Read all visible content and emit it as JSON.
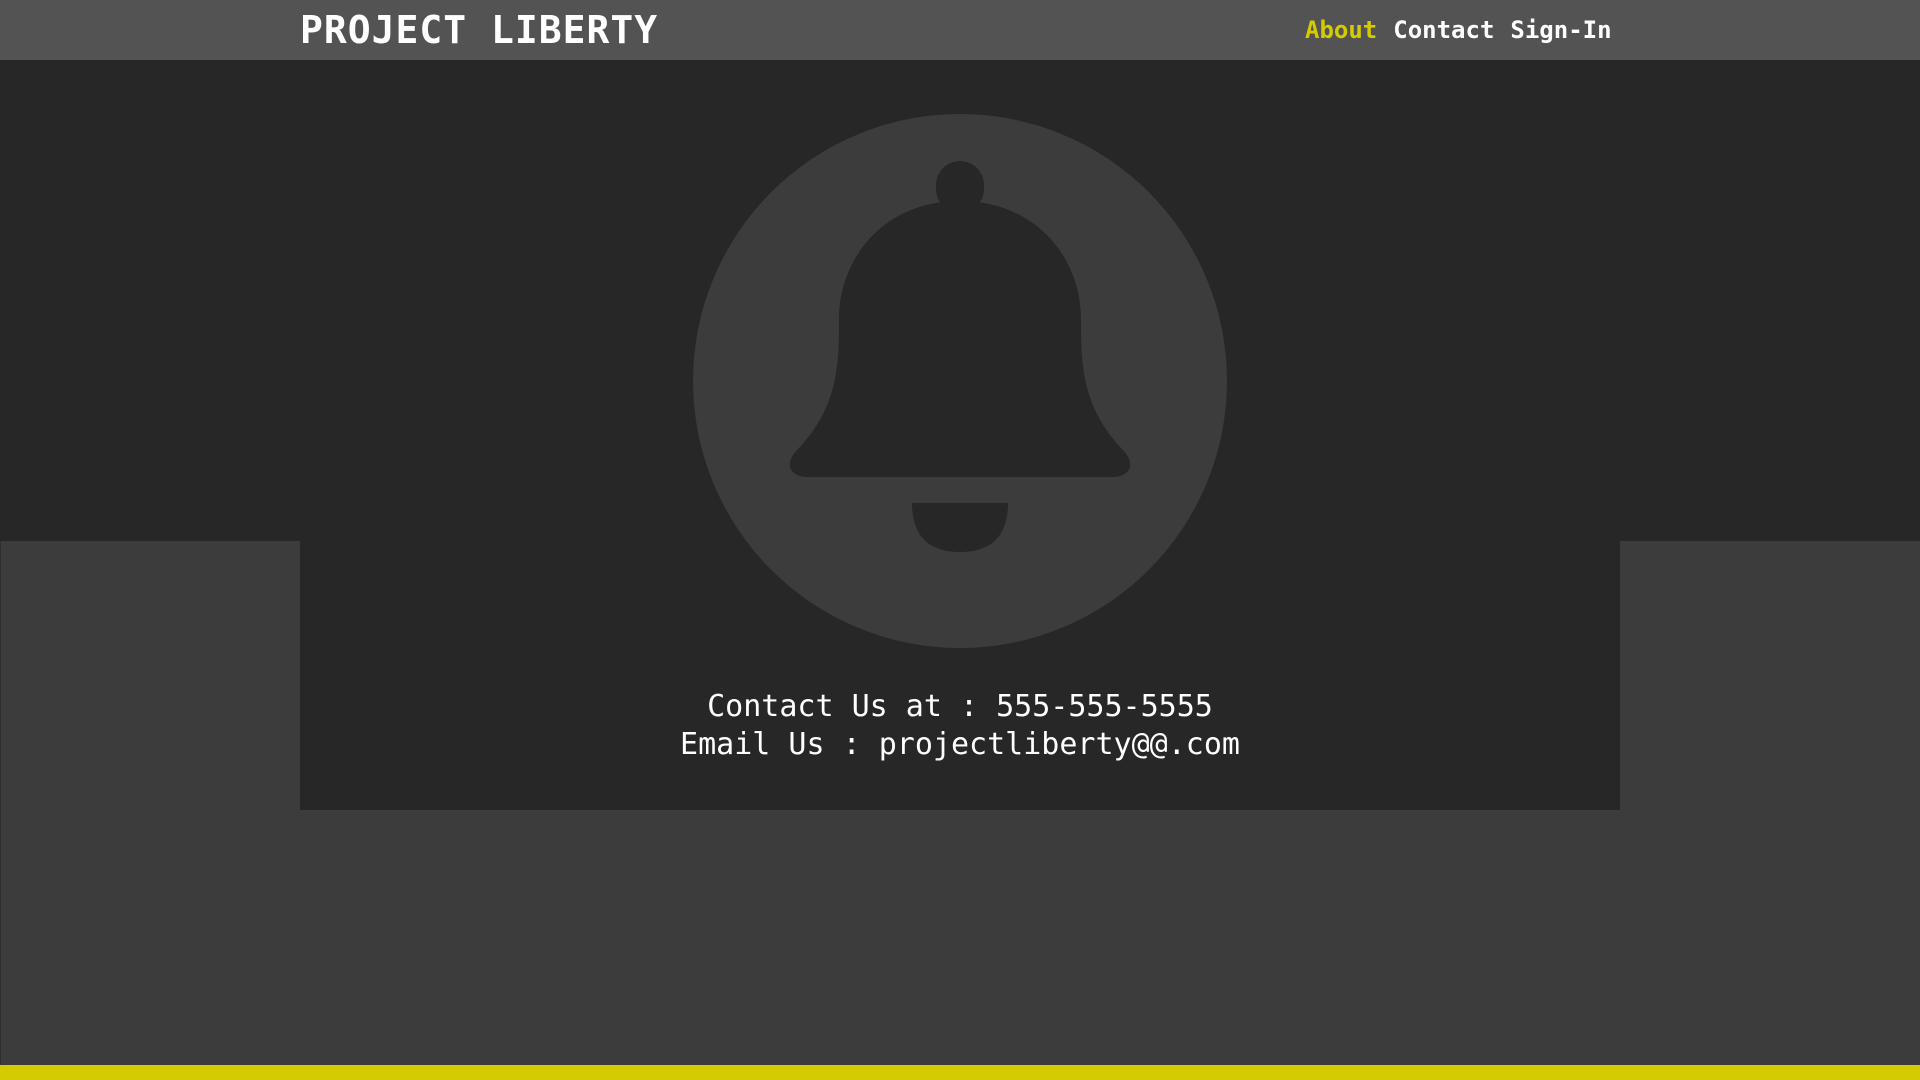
{
  "header": {
    "brand": "PROJECT LIBERTY",
    "nav": [
      {
        "label": "About",
        "active": true
      },
      {
        "label": "Contact",
        "active": false
      },
      {
        "label": "Sign-In",
        "active": false
      }
    ]
  },
  "hero": {
    "icon": "bell-icon"
  },
  "contact": {
    "phone_line": "Contact Us at : 555-555-5555",
    "email_line": "Email Us : projectliberty@@.com"
  },
  "colors": {
    "accent": "#d4cc00",
    "header_bg": "#535353",
    "dark_bg": "#272727",
    "mid_bg": "#3c3c3c",
    "text": "#ffffff"
  }
}
